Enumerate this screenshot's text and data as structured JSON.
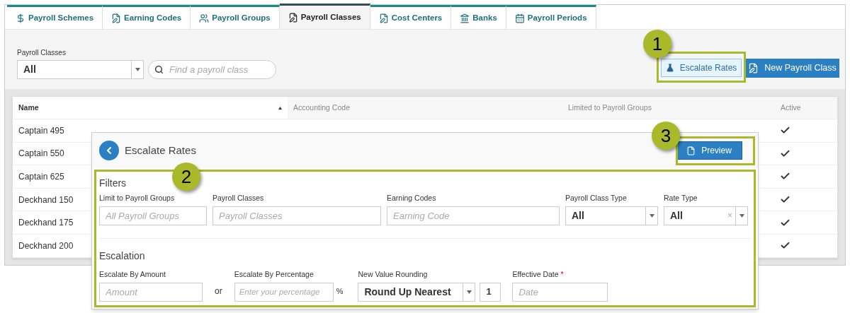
{
  "tabs": [
    {
      "label": "Payroll Schemes",
      "selected": false
    },
    {
      "label": "Earning Codes",
      "selected": false
    },
    {
      "label": "Payroll Groups",
      "selected": false
    },
    {
      "label": "Payroll Classes",
      "selected": true
    },
    {
      "label": "Cost Centers",
      "selected": false
    },
    {
      "label": "Banks",
      "selected": false
    },
    {
      "label": "Payroll Periods",
      "selected": false
    }
  ],
  "toolbar": {
    "filter_label": "Payroll Classes",
    "filter_value": "All",
    "search_placeholder": "Find a payroll class",
    "escalate_button": "Escalate Rates",
    "new_button": "New Payroll Class"
  },
  "table": {
    "columns": [
      {
        "label": "Name",
        "sorted": true
      },
      {
        "label": "Accounting Code",
        "sorted": false
      },
      {
        "label": "Limited to Payroll Groups",
        "sorted": false
      },
      {
        "label": "Active",
        "sorted": false
      }
    ],
    "rows": [
      {
        "name": "Captain 495",
        "active": true
      },
      {
        "name": "Captain 550",
        "active": true
      },
      {
        "name": "Captain 625",
        "active": true
      },
      {
        "name": "Deckhand 150",
        "active": true
      },
      {
        "name": "Deckhand 175",
        "active": true
      },
      {
        "name": "Deckhand 200",
        "active": true
      }
    ]
  },
  "dialog": {
    "title": "Escalate Rates",
    "preview_button": "Preview",
    "filters": {
      "heading": "Filters",
      "limit_groups": {
        "label": "Limit to Payroll Groups",
        "placeholder": "All Payroll Groups"
      },
      "payroll_classes": {
        "label": "Payroll Classes",
        "placeholder": "Payroll Classes"
      },
      "earning_codes": {
        "label": "Earning Codes",
        "placeholder": "Earning Code"
      },
      "class_type": {
        "label": "Payroll Class Type",
        "value": "All"
      },
      "rate_type": {
        "label": "Rate Type",
        "value": "All",
        "clear": "×"
      }
    },
    "escalation": {
      "heading": "Escalation",
      "amount": {
        "label": "Escalate By Amount",
        "placeholder": "Amount"
      },
      "or": "or",
      "percentage": {
        "label": "Escalate By Percentage",
        "placeholder": "Enter your percentage",
        "unit": "%"
      },
      "rounding": {
        "label": "New Value Rounding",
        "value": "Round Up Nearest",
        "step": "1"
      },
      "date": {
        "label": "Effective Date",
        "required_mark": "*",
        "placeholder": "Date"
      }
    }
  },
  "callouts": [
    "1",
    "2",
    "3"
  ]
}
